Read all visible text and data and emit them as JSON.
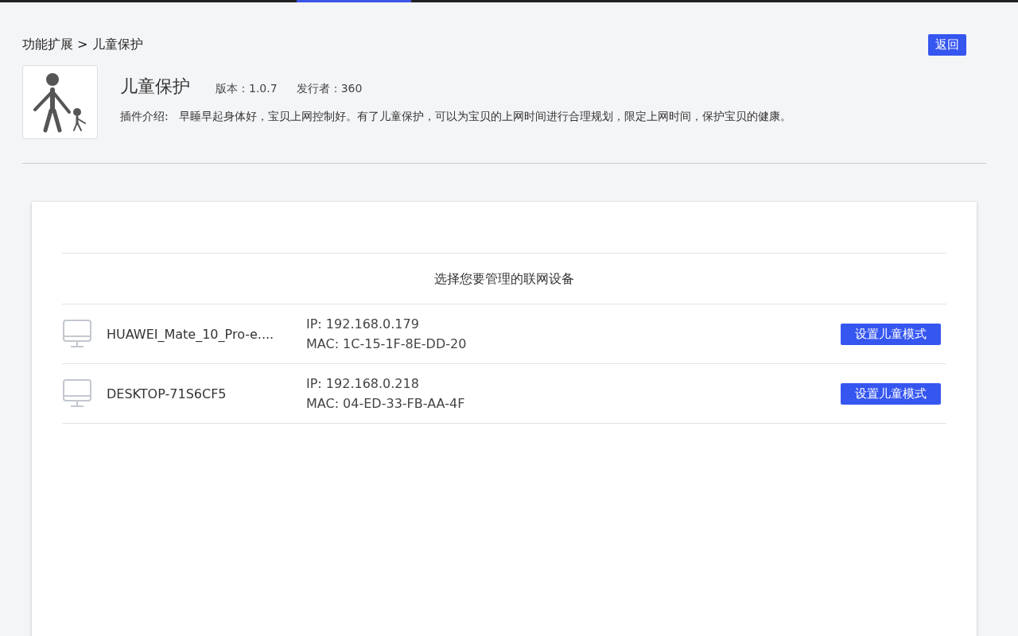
{
  "breadcrumb": {
    "parent": "功能扩展",
    "separator": ">",
    "current": "儿童保护"
  },
  "back_button": "返回",
  "plugin": {
    "name": "儿童保护",
    "version_label": "版本：1.0.7",
    "publisher_label": "发行者：360",
    "description": "插件介绍:   早睡早起身体好，宝贝上网控制好。有了儿童保护，可以为宝贝的上网时间进行合理规划，限定上网时间，保护宝贝的健康。"
  },
  "device_list": {
    "heading": "选择您要管理的联网设备",
    "devices": [
      {
        "name": "HUAWEI_Mate_10_Pro-e....",
        "ip": "IP: 192.168.0.179",
        "mac": "MAC: 1C-15-1F-8E-DD-20",
        "action": "设置儿童模式"
      },
      {
        "name": "DESKTOP-71S6CF5",
        "ip": "IP: 192.168.0.218",
        "mac": "MAC: 04-ED-33-FB-AA-4F",
        "action": "设置儿童模式"
      }
    ]
  }
}
